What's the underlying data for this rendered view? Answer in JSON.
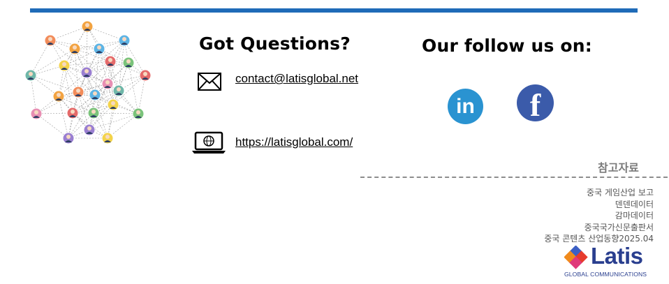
{
  "contact": {
    "title": "Got Questions?",
    "email": "contact@latisglobal.net",
    "website": "https://latisglobal.com/"
  },
  "follow": {
    "title": "Our follow us on:",
    "linkedin_glyph": "in",
    "facebook_glyph": "f"
  },
  "references": {
    "title": "참고자료",
    "items": [
      "중국 게임산업 보고",
      "덴덴데이터",
      "감마데이터",
      "중국국가신문출판서",
      "중국 콘텐츠 산업동향2025.04"
    ]
  },
  "logo": {
    "name": "Latis",
    "tagline": "GLOBAL COMMUNICATIONS"
  },
  "colors": {
    "accent_bar": "#1f6bb8",
    "linkedin": "#2a93d1",
    "facebook": "#3b5baa",
    "logo_text": "#2a3f8f"
  },
  "icons": [
    "network-people-icon",
    "envelope-icon",
    "laptop-globe-icon",
    "linkedin-icon",
    "facebook-icon",
    "latis-logo-icon"
  ]
}
